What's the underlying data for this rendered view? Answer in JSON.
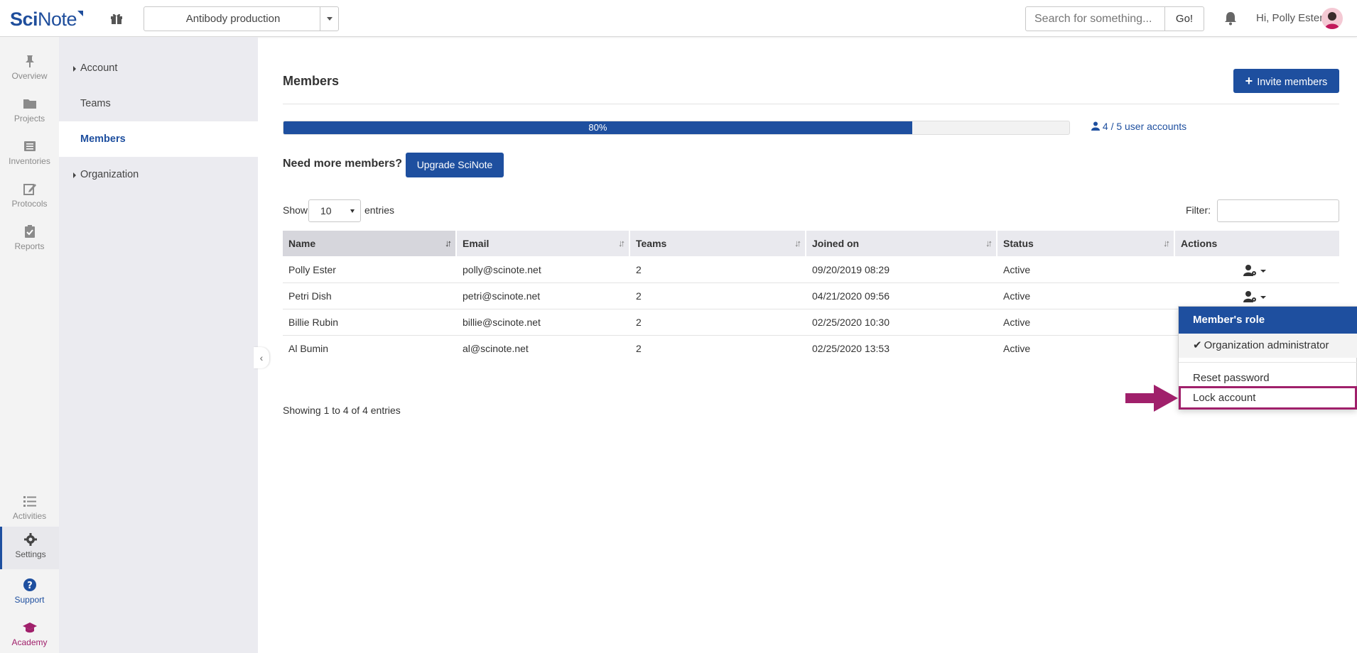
{
  "header": {
    "logo_bold": "Sci",
    "logo_light": "Note",
    "team_name": "Antibody production",
    "search_placeholder": "Search for something...",
    "search_button": "Go!",
    "greeting": "Hi, Polly Ester"
  },
  "rail": {
    "items": [
      {
        "label": "Overview",
        "icon": "pin-icon"
      },
      {
        "label": "Projects",
        "icon": "folder-icon"
      },
      {
        "label": "Inventories",
        "icon": "list-icon"
      },
      {
        "label": "Protocols",
        "icon": "edit-icon"
      },
      {
        "label": "Reports",
        "icon": "clipboard-check-icon"
      },
      {
        "label": "Activities",
        "icon": "activity-list-icon"
      },
      {
        "label": "Settings",
        "icon": "gear-icon"
      },
      {
        "label": "Support",
        "icon": "question-circle-icon"
      },
      {
        "label": "Academy",
        "icon": "graduation-cap-icon"
      }
    ]
  },
  "subnav": {
    "items": [
      {
        "label": "Account"
      },
      {
        "label": "Teams"
      },
      {
        "label": "Members"
      },
      {
        "label": "Organization"
      }
    ]
  },
  "main": {
    "title": "Members",
    "invite_button": "Invite members",
    "progress_label": "80%",
    "progress_fraction": 0.8,
    "accounts": "4 / 5 user accounts",
    "need_more": "Need more members?",
    "upgrade_button": "Upgrade SciNote",
    "show_label": "Show",
    "show_value": "10",
    "entries_label": "entries",
    "filter_label": "Filter:",
    "showing": "Showing 1 to 4 of 4 entries"
  },
  "table": {
    "columns": [
      "Name",
      "Email",
      "Teams",
      "Joined on",
      "Status",
      "Actions"
    ],
    "rows": [
      {
        "name": "Polly Ester",
        "email": "polly@scinote.net",
        "teams": "2",
        "joined": "09/20/2019 08:29",
        "status": "Active"
      },
      {
        "name": "Petri Dish",
        "email": "petri@scinote.net",
        "teams": "2",
        "joined": "04/21/2020 09:56",
        "status": "Active"
      },
      {
        "name": "Billie Rubin",
        "email": "billie@scinote.net",
        "teams": "2",
        "joined": "02/25/2020 10:30",
        "status": "Active"
      },
      {
        "name": "Al Bumin",
        "email": "al@scinote.net",
        "teams": "2",
        "joined": "02/25/2020 13:53",
        "status": "Active"
      }
    ]
  },
  "dropdown": {
    "header": "Member's role",
    "role": "Organization administrator",
    "reset": "Reset password",
    "lock": "Lock account"
  },
  "colors": {
    "brand": "#1e4f9f",
    "highlight": "#a0206b"
  }
}
